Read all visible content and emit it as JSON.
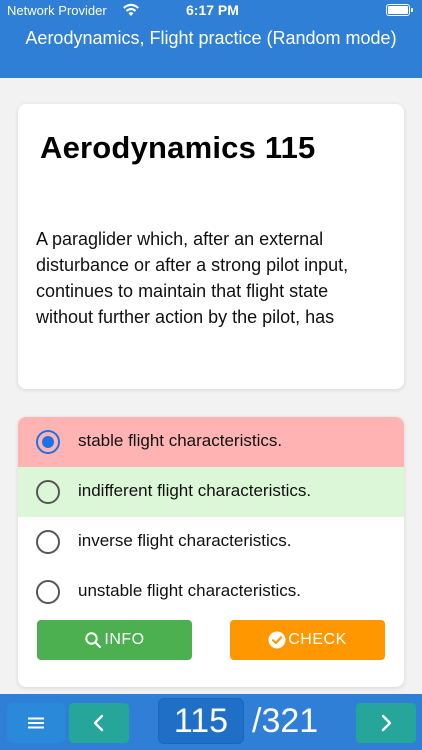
{
  "status_bar": {
    "carrier": "Network Provider",
    "time": "6:17 PM"
  },
  "header": {
    "title": "Aerodynamics, Flight practice (Random mode)"
  },
  "question": {
    "title": "Aerodynamics 115",
    "text": "A paraglider which, after an external disturbance or after a strong pilot input, continues to maintain that flight state without further action by the pilot, has"
  },
  "answers": [
    {
      "label": "stable flight characteristics.",
      "state": "selected-wrong",
      "background": "#ffb3b3"
    },
    {
      "label": "indifferent flight characteristics.",
      "state": "correct",
      "background": "#dcf7d7"
    },
    {
      "label": "inverse flight characteristics.",
      "state": "normal",
      "background": "#ffffff"
    },
    {
      "label": "unstable flight characteristics.",
      "state": "normal",
      "background": "#ffffff"
    }
  ],
  "actions": {
    "info_label": "INFO",
    "check_label": "CHECK"
  },
  "pagination": {
    "current": "115",
    "total": "/321"
  },
  "colors": {
    "primary_blue": "#2f7fd6",
    "info_green": "#4caf50",
    "check_orange": "#ff9800",
    "nav_teal": "#26a69a",
    "selected_radio": "#1a73e8"
  }
}
